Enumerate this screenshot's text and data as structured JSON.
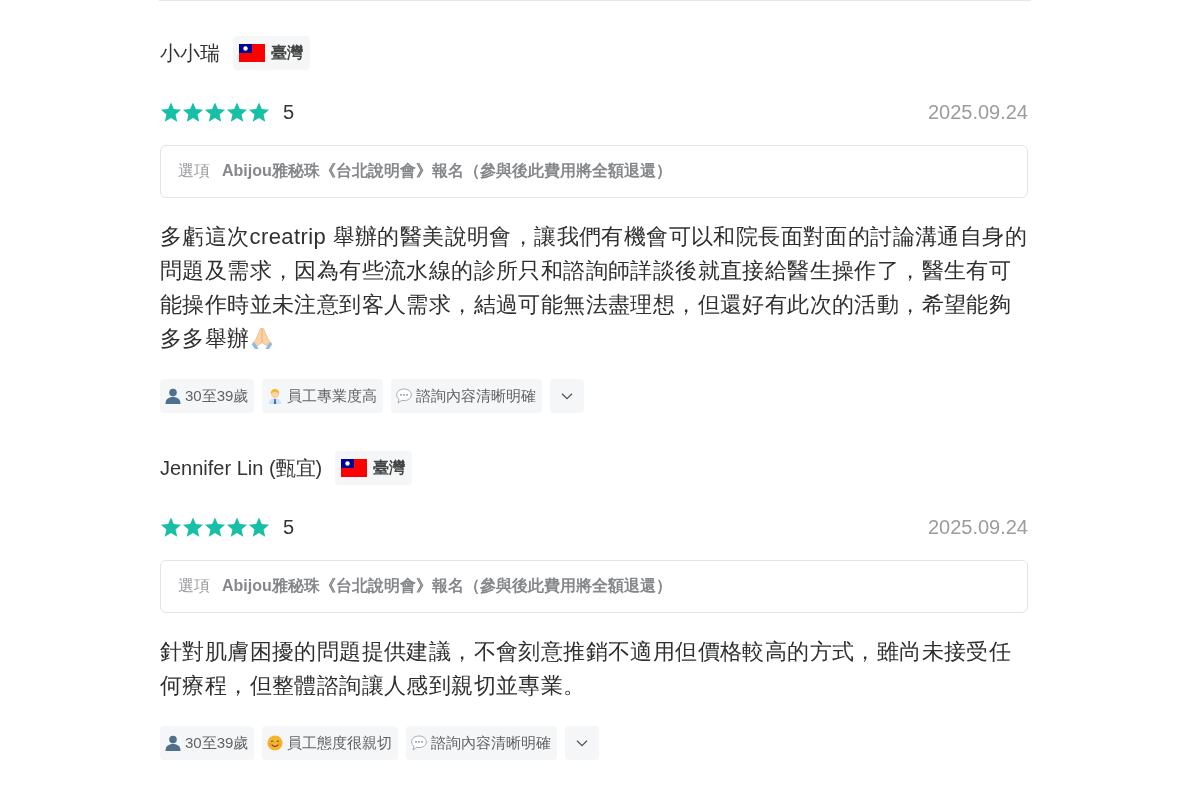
{
  "reviews": [
    {
      "name": "小小瑞",
      "country": {
        "label": "臺灣"
      },
      "stars": 5,
      "rating": "5",
      "date": "2025.09.24",
      "option": {
        "label": "選項",
        "value": "Abijou雅秘珠《台北說明會》報名（參與後此費用將全額退還）"
      },
      "body": "多虧這次creatrip 舉辦的醫美說明會，讓我們有機會可以和院長面對面的討論溝通自身的問題及需求，因為有些流水線的診所只和諮詢師詳談後就直接給醫生操作了，醫生有可能操作時並未注意到客人需求，結過可能無法盡理想，但還好有此次的活動，希望能夠多多舉辦",
      "trailing_icon": true,
      "tags": [
        {
          "kind": "age",
          "label": "30至39歲"
        },
        {
          "kind": "professional",
          "label": "員工專業度高"
        },
        {
          "kind": "consultation",
          "label": "諮詢內容清晰明確"
        }
      ],
      "more_button": {
        "expanded": false
      }
    },
    {
      "name": "Jennifer Lin (甄宜)",
      "country": {
        "label": "臺灣"
      },
      "stars": 5,
      "rating": "5",
      "date": "2025.09.24",
      "option": {
        "label": "選項",
        "value": "Abijou雅秘珠《台北說明會》報名（參與後此費用將全額退還）"
      },
      "body": "針對肌膚困擾的問題提供建議，不會刻意推銷不適用但價格較高的方式，雖尚未接受任何療程，但整體諮詢讓人感到親切並專業。",
      "trailing_icon": false,
      "tags": [
        {
          "kind": "age",
          "label": "30至39歲"
        },
        {
          "kind": "friendly",
          "label": "員工態度很親切"
        },
        {
          "kind": "consultation",
          "label": "諮詢內容清晰明確"
        }
      ],
      "more_button": {
        "expanded": false
      }
    }
  ]
}
